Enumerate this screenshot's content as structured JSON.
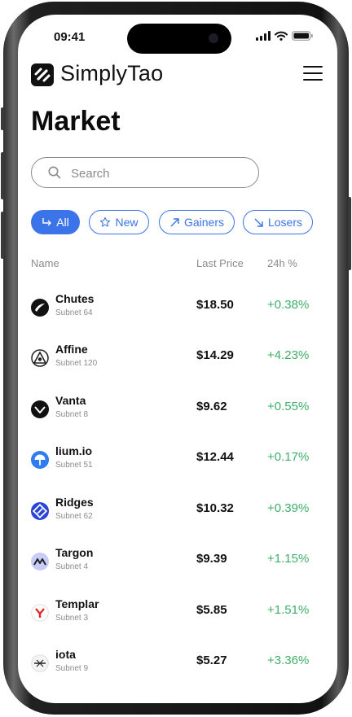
{
  "status_bar": {
    "time": "09:41"
  },
  "app": {
    "brand": "SimplyTao"
  },
  "page": {
    "title": "Market"
  },
  "search": {
    "placeholder": "Search",
    "value": ""
  },
  "filters": [
    {
      "label": "All",
      "icon": "return-arrow-icon",
      "active": true
    },
    {
      "label": "New",
      "icon": "star-icon",
      "active": false
    },
    {
      "label": "Gainers",
      "icon": "arrow-up-right-icon",
      "active": false
    },
    {
      "label": "Losers",
      "icon": "arrow-down-right-icon",
      "active": false
    }
  ],
  "columns": {
    "name": "Name",
    "price": "Last Price",
    "change": "24h %"
  },
  "accent_color": "#3a74e8",
  "positive_color": "#3fae68",
  "rows": [
    {
      "name": "Chutes",
      "subnet": "Subnet 64",
      "price": "$18.50",
      "change": "+0.38%",
      "icon": "chutes-icon"
    },
    {
      "name": "Affine",
      "subnet": "Subnet 120",
      "price": "$14.29",
      "change": "+4.23%",
      "icon": "affine-icon"
    },
    {
      "name": "Vanta",
      "subnet": "Subnet 8",
      "price": "$9.62",
      "change": "+0.55%",
      "icon": "vanta-icon"
    },
    {
      "name": "lium.io",
      "subnet": "Subnet 51",
      "price": "$12.44",
      "change": "+0.17%",
      "icon": "lium-icon"
    },
    {
      "name": "Ridges",
      "subnet": "Subnet 62",
      "price": "$10.32",
      "change": "+0.39%",
      "icon": "ridges-icon"
    },
    {
      "name": "Targon",
      "subnet": "Subnet 4",
      "price": "$9.39",
      "change": "+1.15%",
      "icon": "targon-icon"
    },
    {
      "name": "Templar",
      "subnet": "Subnet 3",
      "price": "$5.85",
      "change": "+1.51%",
      "icon": "templar-icon"
    },
    {
      "name": "iota",
      "subnet": "Subnet 9",
      "price": "$5.27",
      "change": "+3.36%",
      "icon": "iota-icon"
    }
  ]
}
